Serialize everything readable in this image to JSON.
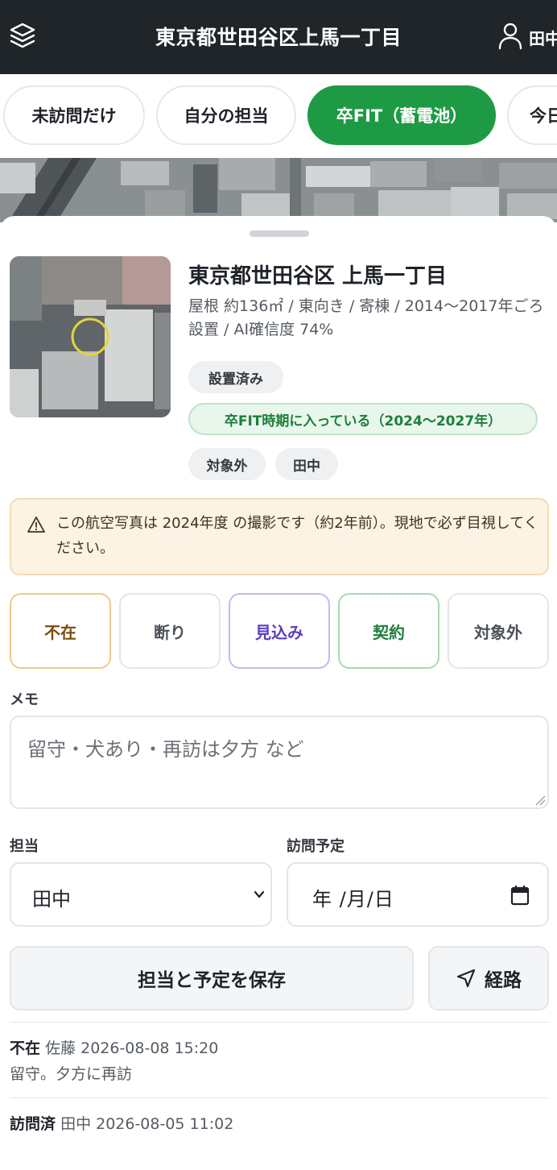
{
  "header": {
    "title": "東京都世田谷区上馬一丁目",
    "user_name": "田中"
  },
  "filters": [
    {
      "label": "未訪問だけ",
      "active": false
    },
    {
      "label": "自分の担当",
      "active": false
    },
    {
      "label": "卒FIT（蓄電池）",
      "active": true
    },
    {
      "label": "今日",
      "active": false
    }
  ],
  "property": {
    "address": "東京都世田谷区 上馬一丁目",
    "meta": "屋根 約136㎡ / 東向き / 寄棟 / 2014〜2017年ごろ設置 / AI確信度 74%",
    "tags": {
      "installed": "設置済み",
      "fit": "卒FIT時期に入っている（2024〜2027年）",
      "excluded": "対象外",
      "assignee": "田中"
    }
  },
  "notice": {
    "text": "この航空写真は 2024年度 の撮影です（約2年前）。現地で必ず目視してください。"
  },
  "status_buttons": [
    {
      "label": "不在"
    },
    {
      "label": "断り"
    },
    {
      "label": "見込み"
    },
    {
      "label": "契約"
    },
    {
      "label": "対象外"
    }
  ],
  "form": {
    "memo_label": "メモ",
    "memo_placeholder": "留守・犬あり・再訪は夕方 など",
    "assignee_label": "担当",
    "assignee_value": "田中",
    "visit_label": "訪問予定",
    "visit_placeholder": "年 /月/日",
    "save_label": "担当と予定を保存",
    "route_label": "経路"
  },
  "history": [
    {
      "status": "不在",
      "meta": "佐藤 2026-08-08 15:20",
      "note": "留守。夕方に再訪"
    },
    {
      "status": "訪問済",
      "meta": "田中 2026-08-05 11:02",
      "note": ""
    }
  ],
  "colors": {
    "header_bg": "#1f2528",
    "accent_green": "#1e9a44",
    "notice_bg": "#fdf3e4"
  }
}
